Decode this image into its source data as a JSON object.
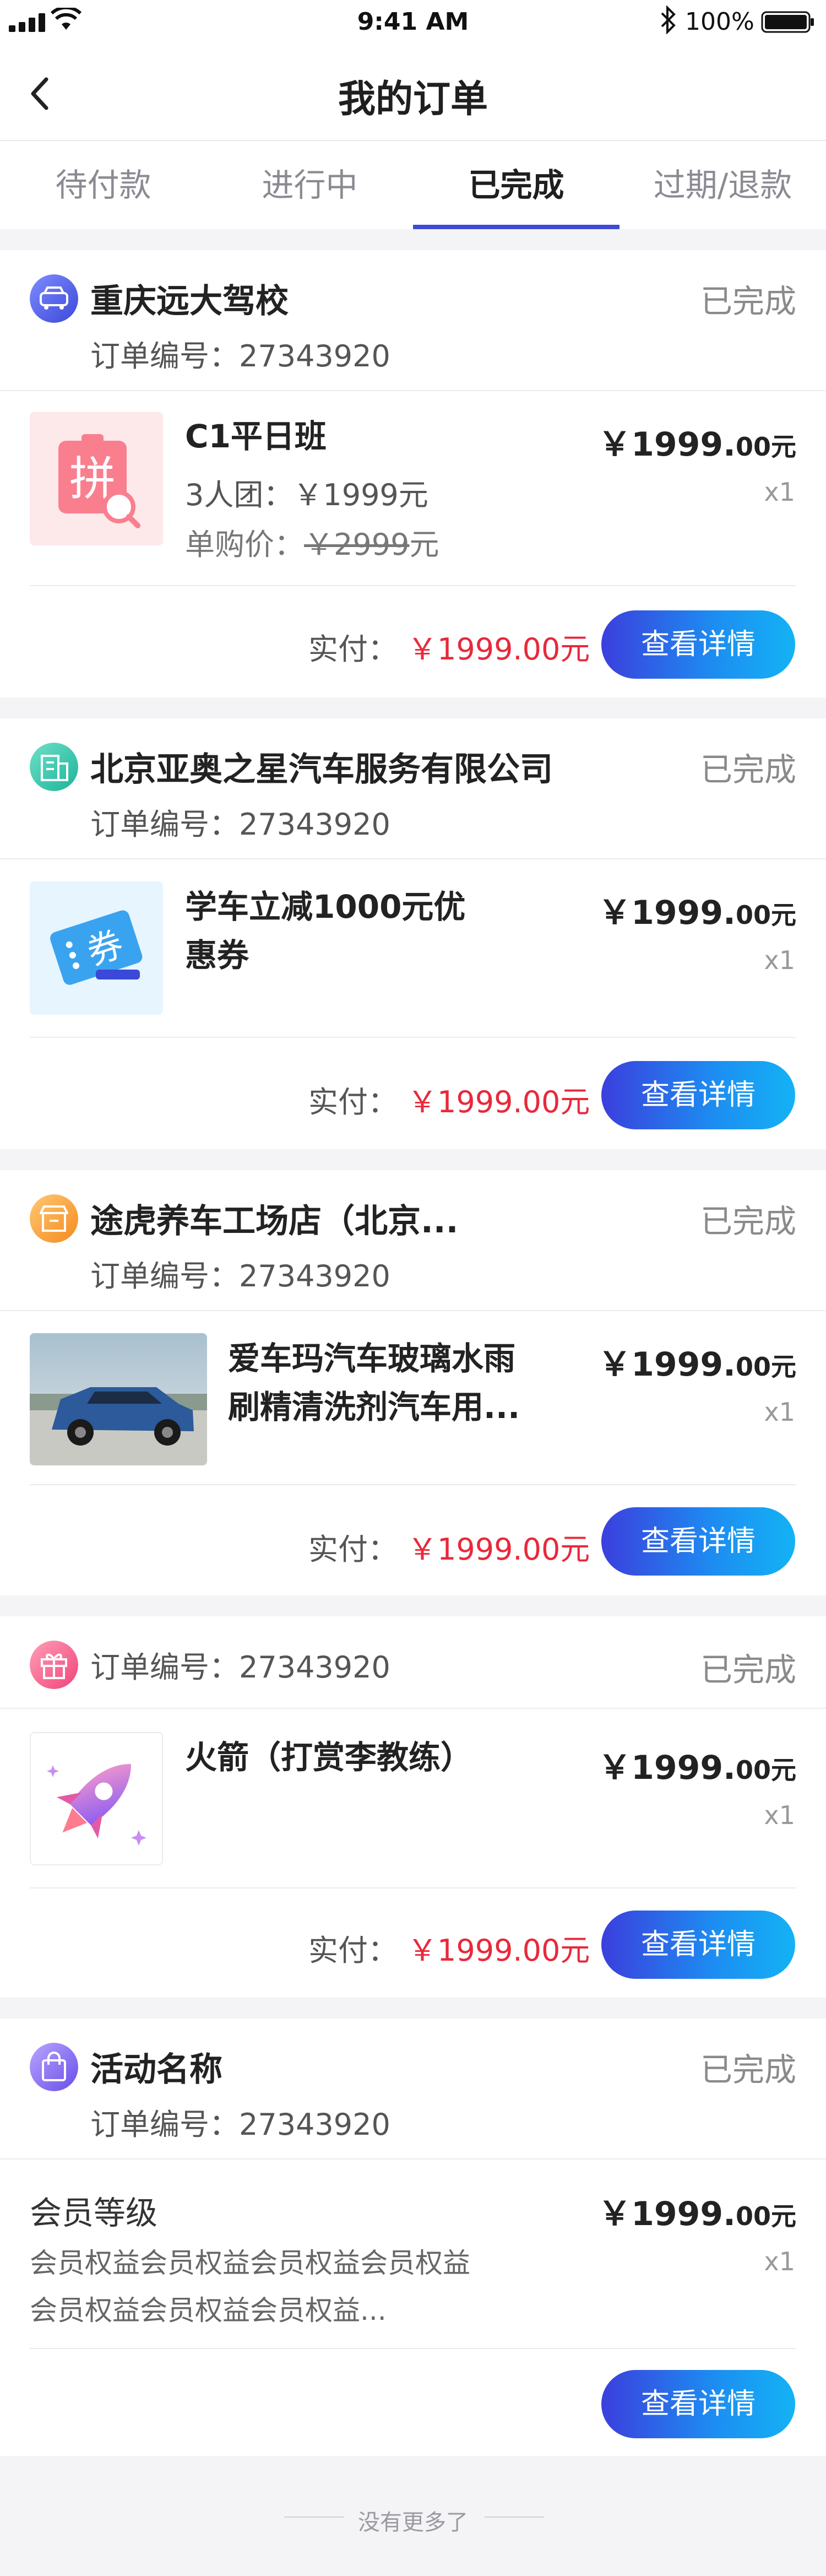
{
  "statusbar": {
    "time": "9:41 AM",
    "battery": "100%"
  },
  "nav": {
    "title": "我的订单"
  },
  "tabs": [
    {
      "label": "待付款"
    },
    {
      "label": "进行中"
    },
    {
      "label": "已完成",
      "active": true
    },
    {
      "label": "过期/退款"
    }
  ],
  "orders": [
    {
      "shop": "重庆远大驾校",
      "order_no": "订单编号：27343920",
      "status": "已完成",
      "item_title": "C1平日班",
      "group_price": "3人团：￥1999元",
      "single_price_label": "单购价：",
      "single_price_original": "￥2999",
      "single_price_unit": "元",
      "thumb_text": "拼",
      "price_main": "￥1999.",
      "price_cents": "00元",
      "qty": "x1",
      "paid_label": "实付：",
      "paid_value": "￥1999.00元",
      "button": "查看详情"
    },
    {
      "shop": "北京亚奥之星汽车服务有限公司",
      "order_no": "订单编号：27343920",
      "status": "已完成",
      "item_title_line1": "学车立减1000元优",
      "item_title_line2": "惠券",
      "thumb_text": "券",
      "price_main": "￥1999.",
      "price_cents": "00元",
      "qty": "x1",
      "paid_label": "实付：",
      "paid_value": "￥1999.00元",
      "button": "查看详情"
    },
    {
      "shop": "途虎养车工场店（北京...",
      "order_no": "订单编号：27343920",
      "status": "已完成",
      "item_title_line1": "爱车玛汽车玻璃水雨",
      "item_title_line2": "刷精清洗剂汽车用...",
      "price_main": "￥1999.",
      "price_cents": "00元",
      "qty": "x1",
      "paid_label": "实付：",
      "paid_value": "￥1999.00元",
      "button": "查看详情"
    },
    {
      "order_no": "订单编号：27343920",
      "status": "已完成",
      "item_title": "火箭（打赏李教练）",
      "price_main": "￥1999.",
      "price_cents": "00元",
      "qty": "x1",
      "paid_label": "实付：",
      "paid_value": "￥1999.00元",
      "button": "查看详情"
    },
    {
      "shop": "活动名称",
      "order_no": "订单编号：27343920",
      "status": "已完成",
      "item_title": "会员等级",
      "desc_line1": "会员权益会员权益会员权益会员权益",
      "desc_line2": "会员权益会员权益会员权益...",
      "price_main": "￥1999.",
      "price_cents": "00元",
      "qty": "x1",
      "button": "查看详情"
    }
  ],
  "footer": {
    "text": "没有更多了"
  },
  "colors": {
    "accent": "#3f4ad6",
    "price_red": "#e8293b",
    "button_gradient_start": "#3b3fdd",
    "button_gradient_end": "#14b2f5"
  }
}
